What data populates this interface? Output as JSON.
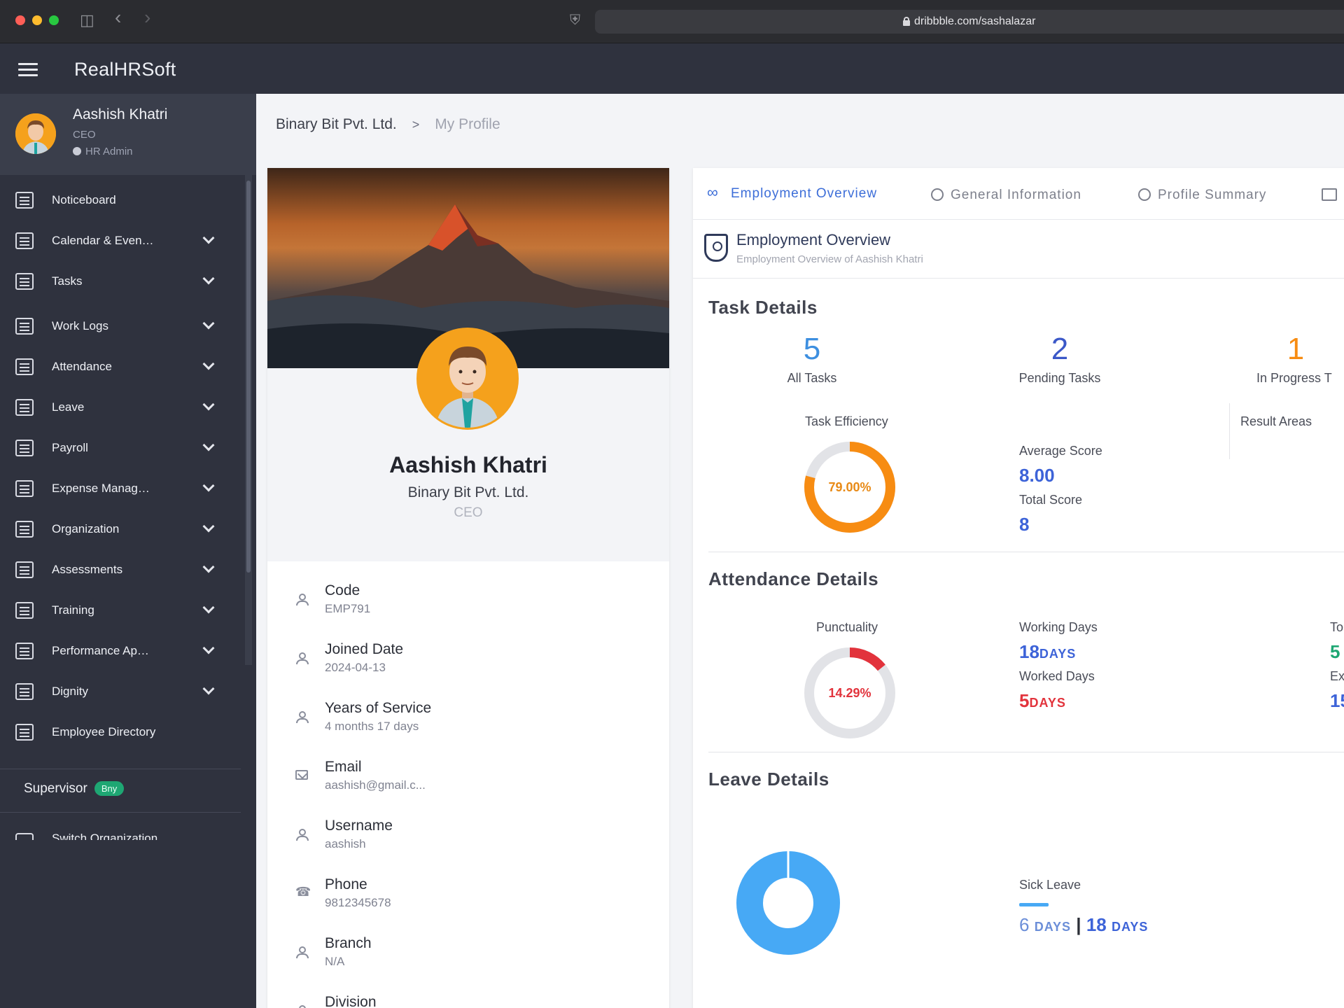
{
  "browser": {
    "url": "dribbble.com/sashalazar"
  },
  "app": {
    "brand": "RealHRSoft"
  },
  "user": {
    "name": "Aashish Khatri",
    "role": "CEO",
    "admin": "HR Admin"
  },
  "sidebar": {
    "items": [
      {
        "label": "Noticeboard",
        "icon": "noticeboard-icon",
        "expandable": false
      },
      {
        "label": "Calendar & Even…",
        "icon": "calendar-icon",
        "expandable": true
      },
      {
        "label": "Tasks",
        "icon": "tasks-icon",
        "expandable": true
      },
      {
        "label": "Work Logs",
        "icon": "worklogs-icon",
        "expandable": true
      },
      {
        "label": "Attendance",
        "icon": "fingerprint-icon",
        "expandable": true
      },
      {
        "label": "Leave",
        "icon": "leave-icon",
        "expandable": true
      },
      {
        "label": "Payroll",
        "icon": "payroll-icon",
        "expandable": true
      },
      {
        "label": "Expense Manag…",
        "icon": "expense-icon",
        "expandable": true
      },
      {
        "label": "Organization",
        "icon": "organization-icon",
        "expandable": true
      },
      {
        "label": "Assessments",
        "icon": "assessments-icon",
        "expandable": true
      },
      {
        "label": "Training",
        "icon": "training-icon",
        "expandable": true
      },
      {
        "label": "Performance Ap…",
        "icon": "performance-icon",
        "expandable": true
      },
      {
        "label": "Dignity",
        "icon": "dignity-icon",
        "expandable": true
      },
      {
        "label": "Employee Directory",
        "icon": "directory-icon",
        "expandable": false
      }
    ],
    "supervisor_label": "Supervisor",
    "supervisor_badge": "Bny",
    "switch_org": "Switch Organization"
  },
  "breadcrumb": {
    "company": "Binary Bit Pvt. Ltd.",
    "separator": ">",
    "current": "My Profile"
  },
  "profile_card": {
    "name": "Aashish Khatri",
    "company": "Binary Bit Pvt. Ltd.",
    "role": "CEO",
    "details": [
      {
        "label": "Code",
        "value": "EMP791",
        "icon": "person-icon"
      },
      {
        "label": "Joined Date",
        "value": "2024-04-13",
        "icon": "person-icon"
      },
      {
        "label": "Years of Service",
        "value": "4 months 17 days",
        "icon": "person-icon"
      },
      {
        "label": "Email",
        "value": "aashish@gmail.c...",
        "icon": "mail-icon"
      },
      {
        "label": "Username",
        "value": "aashish",
        "icon": "person-icon"
      },
      {
        "label": "Phone",
        "value": "9812345678",
        "icon": "phone-icon"
      },
      {
        "label": "Branch",
        "value": "N/A",
        "icon": "person-icon"
      },
      {
        "label": "Division",
        "value": "",
        "icon": "person-icon"
      }
    ]
  },
  "tabs": [
    {
      "label": "Employment Overview",
      "active": true,
      "icon": "infinity-icon"
    },
    {
      "label": "General Information",
      "active": false,
      "icon": "info-icon"
    },
    {
      "label": "Profile Summary",
      "active": false,
      "icon": "globe-icon"
    },
    {
      "label": "",
      "active": false,
      "icon": "image-icon"
    }
  ],
  "overview": {
    "title": "Employment Overview",
    "subtitle": "Employment Overview of Aashish Khatri"
  },
  "tasks": {
    "title": "Task Details",
    "all_count": "5",
    "all_label": "All Tasks",
    "pending_count": "2",
    "pending_label": "Pending Tasks",
    "progress_count": "1",
    "progress_label": "In Progress T",
    "efficiency_label": "Task Efficiency",
    "efficiency_value": "79.00%",
    "efficiency_fraction": 0.79,
    "average_label": "Average Score",
    "average_value": "8.00",
    "total_label": "Total Score",
    "total_value": "8",
    "result_areas_label": "Result Areas"
  },
  "attendance": {
    "title": "Attendance Details",
    "punctuality_label": "Punctuality",
    "punctuality_value": "14.29%",
    "punctuality_fraction": 0.1429,
    "working_days_label": "Working Days",
    "working_days_value": "18",
    "worked_days_label": "Worked Days",
    "worked_days_value": "5",
    "days_unit": "DAYS",
    "cut_label_1": "To",
    "cut_value_1": "5",
    "cut_label_2": "Ex",
    "cut_value_2": "15"
  },
  "leave": {
    "title": "Leave Details",
    "type_label": "Sick Leave",
    "used": "6",
    "total": "18",
    "unit": "DAYS",
    "separator": "|"
  },
  "colors": {
    "accent": "#3d63d8",
    "orange": "#f78c12",
    "red": "#e2333c",
    "green": "#1ea773",
    "leave_blue": "#47a9f5",
    "sidebar_bg": "#2f323e"
  }
}
